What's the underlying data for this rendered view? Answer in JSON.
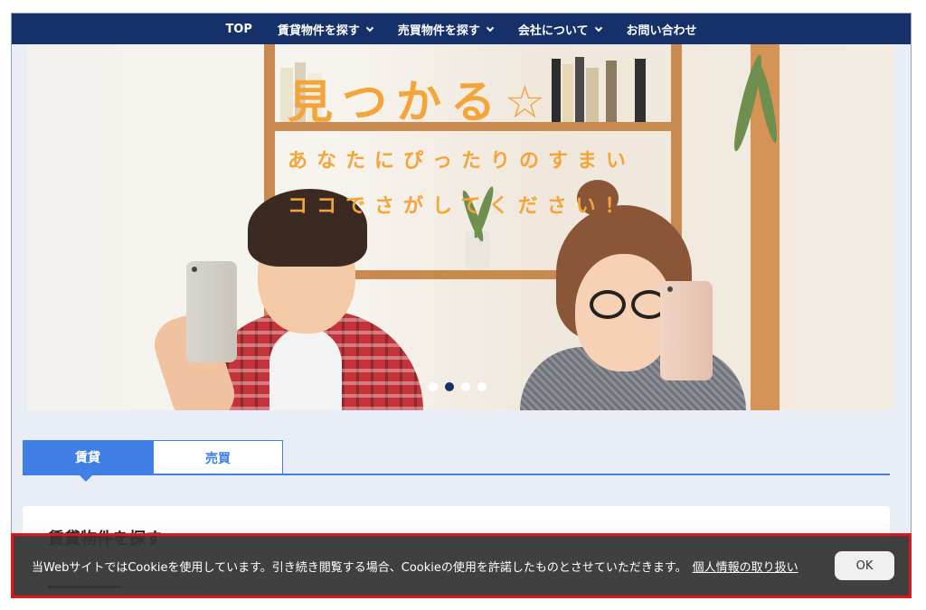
{
  "nav": {
    "items": [
      {
        "label": "TOP",
        "has_dropdown": false
      },
      {
        "label": "賃貸物件を探す",
        "has_dropdown": true
      },
      {
        "label": "売買物件を探す",
        "has_dropdown": true
      },
      {
        "label": "会社について",
        "has_dropdown": true
      },
      {
        "label": "お問い合わせ",
        "has_dropdown": false
      }
    ]
  },
  "hero": {
    "title": "見つかる☆",
    "subtitle_line1": "あなたにぴったりのすまい",
    "subtitle_line2": "ココでさがしてください！",
    "slides": 4,
    "active_slide": 2
  },
  "tabs": [
    {
      "label": "賃貸",
      "active": true
    },
    {
      "label": "売買",
      "active": false
    }
  ],
  "search_card": {
    "title": "賃貸物件を探す"
  },
  "cookie_banner": {
    "message": "当WebサイトではCookieを使用しています。引き続き閲覧する場合、Cookieの使用を許諾したものとさせていただきます。",
    "link_label": "個人情報の取り扱い",
    "ok_label": "OK"
  },
  "colors": {
    "nav_bg": "#16306a",
    "accent": "#3f7fe6",
    "hero_text": "#f4a53a",
    "banner_border": "#e0161b"
  }
}
